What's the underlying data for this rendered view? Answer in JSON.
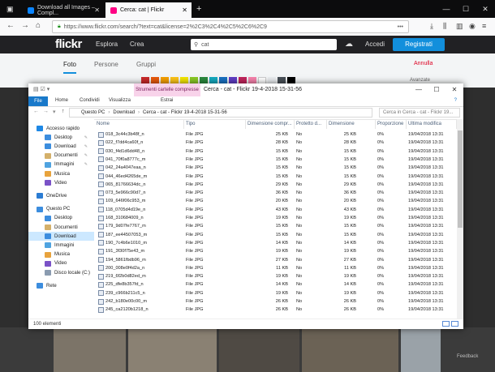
{
  "browser": {
    "tabs": [
      {
        "label": "Download all Images – Compl...",
        "favicon_color": "#0a84ff"
      },
      {
        "label": "Cerca: cat | Flickr",
        "favicon_color": "#ff0084"
      }
    ],
    "url": "https://www.flickr.com/search/?text=cat&license=2%2C3%2C4%2C5%2C6%2C9",
    "url_more": "•••",
    "new_tab": "+"
  },
  "flickr": {
    "logo": "flickr",
    "menu": [
      "Esplora",
      "Crea"
    ],
    "search_value": "cat",
    "login": "Accedi",
    "signup": "Registrati",
    "tabs": [
      "Foto",
      "Persone",
      "Gruppi"
    ],
    "cancel": "Annulla",
    "advanced": "Avanzate",
    "feedback": "Feedback",
    "swatch_colors": [
      "#c92a2a",
      "#e8590c",
      "#f59f00",
      "#fcc419",
      "#f3e600",
      "#8ac926",
      "#2b8a3e",
      "#15aabf",
      "#1971c2",
      "#5f3dc4",
      "#c2255c",
      "#f783ac",
      "#ffffff",
      "#e9ecef",
      "#495057",
      "#000000"
    ]
  },
  "explorer": {
    "ribbon_context": "Strumenti cartelle compresse",
    "title_path": "Cerca - cat - Flickr 19-4-2018 15-31-56",
    "ribbon_tabs": [
      "File",
      "Home",
      "Condividi",
      "Visualizza",
      "Estrai"
    ],
    "breadcrumb": [
      "Questo PC",
      "Download",
      "Cerca - cat - Flickr 19-4-2018 15-31-56"
    ],
    "search_placeholder": "Cerca in Cerca - cat - Flickr 19...",
    "nav": [
      {
        "label": "Accesso rapido",
        "level": 0,
        "color": "#1e88e5",
        "pin": false
      },
      {
        "label": "Desktop",
        "level": 1,
        "color": "#3c8dde",
        "pin": true
      },
      {
        "label": "Download",
        "level": 1,
        "color": "#3c8dde",
        "pin": true
      },
      {
        "label": "Documenti",
        "level": 1,
        "color": "#d4b06a",
        "pin": true
      },
      {
        "label": "Immagini",
        "level": 1,
        "color": "#4fa3e0",
        "pin": true
      },
      {
        "label": "Musica",
        "level": 1,
        "color": "#e8a33d",
        "pin": false
      },
      {
        "label": "Video",
        "level": 1,
        "color": "#7a52c7",
        "pin": false
      },
      {
        "label": "OneDrive",
        "level": 0,
        "color": "#2b7cd3",
        "pin": false
      },
      {
        "label": "Questo PC",
        "level": 0,
        "color": "#3c8dde",
        "pin": false
      },
      {
        "label": "Desktop",
        "level": 1,
        "color": "#3c8dde",
        "pin": false
      },
      {
        "label": "Documenti",
        "level": 1,
        "color": "#d4b06a",
        "pin": false
      },
      {
        "label": "Download",
        "level": 1,
        "color": "#3c8dde",
        "pin": false,
        "selected": true
      },
      {
        "label": "Immagini",
        "level": 1,
        "color": "#4fa3e0",
        "pin": false
      },
      {
        "label": "Musica",
        "level": 1,
        "color": "#e8a33d",
        "pin": false
      },
      {
        "label": "Video",
        "level": 1,
        "color": "#7a52c7",
        "pin": false
      },
      {
        "label": "Disco locale (C:)",
        "level": 1,
        "color": "#8a9bb0",
        "pin": false
      },
      {
        "label": "Rete",
        "level": 0,
        "color": "#3c8dde",
        "pin": false
      }
    ],
    "columns": [
      "Nome",
      "Tipo",
      "Dimensione compr...",
      "Protetto d...",
      "Dimensione",
      "Proporzione",
      "Ultima modifica"
    ],
    "files": [
      [
        "018_3c44c3b48f_n",
        "25 KB"
      ],
      [
        "022_f7dd4ca60f_n",
        "28 KB"
      ],
      [
        "030_f4d1d6dd48_n",
        "15 KB"
      ],
      [
        "041_70f0a8777c_m",
        "15 KB"
      ],
      [
        "042_24a4047eaa_n",
        "15 KB"
      ],
      [
        "044_46ed4265de_m",
        "15 KB"
      ],
      [
        "065_81766634dc_n",
        "29 KB"
      ],
      [
        "073_5e966c90d7_n",
        "36 KB"
      ],
      [
        "109_646f06c953_m",
        "20 KB"
      ],
      [
        "118_0705d4d19e_n",
        "43 KB"
      ],
      [
        "168_310684009_n",
        "19 KB"
      ],
      [
        "179_9d07fe7767_m",
        "15 KB"
      ],
      [
        "187_ee44507053_m",
        "15 KB"
      ],
      [
        "190_7c4b6e1010_m",
        "14 KB"
      ],
      [
        "191_3f30f75e43_m",
        "19 KB"
      ],
      [
        "194_5861fbdb96_m",
        "27 KB"
      ],
      [
        "200_008e0f4d2a_n",
        "11 KB"
      ],
      [
        "219_6f2b0d82ed_m",
        "19 KB"
      ],
      [
        "225_dfe8b357fd_n",
        "14 KB"
      ],
      [
        "239_c966b211c5_n",
        "19 KB"
      ],
      [
        "242_b180e00c00_m",
        "26 KB"
      ],
      [
        "245_ca2120b1218_n",
        "26 KB"
      ]
    ],
    "file_type": "File JPG",
    "file_protected": "No",
    "file_ratio": "0%",
    "file_modified": "19/04/2018 13:31",
    "status": "100 elementi"
  }
}
